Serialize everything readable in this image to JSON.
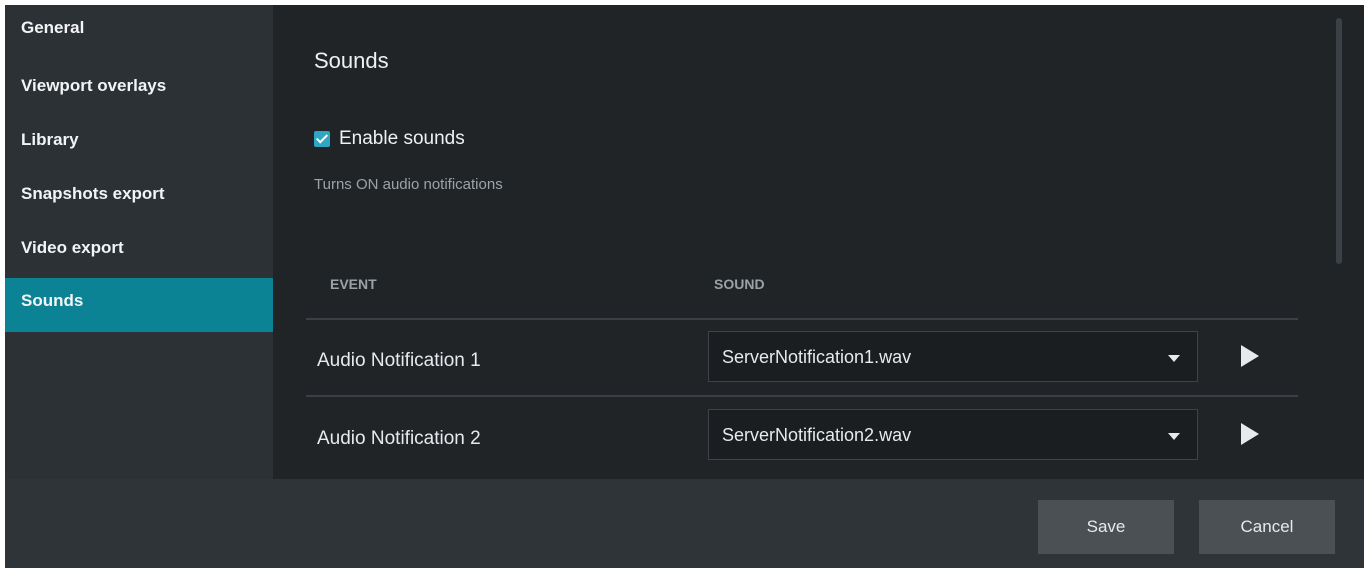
{
  "sidebar": {
    "items": [
      {
        "label": "General",
        "active": false
      },
      {
        "label": "Viewport overlays",
        "active": false
      },
      {
        "label": "Library",
        "active": false
      },
      {
        "label": "Snapshots export",
        "active": false
      },
      {
        "label": "Video export",
        "active": false
      },
      {
        "label": "Sounds",
        "active": true
      }
    ]
  },
  "main": {
    "title": "Sounds",
    "enable_sounds": {
      "label": "Enable sounds",
      "checked": true
    },
    "hint": "Turns ON audio notifications",
    "table": {
      "headers": {
        "event": "EVENT",
        "sound": "SOUND"
      },
      "rows": [
        {
          "event": "Audio Notification 1",
          "sound": "ServerNotification1.wav"
        },
        {
          "event": "Audio Notification 2",
          "sound": "ServerNotification2.wav"
        }
      ]
    }
  },
  "footer": {
    "save_label": "Save",
    "cancel_label": "Cancel"
  },
  "colors": {
    "accent": "#0b8394",
    "checkbox": "#2fa7c4",
    "background": "#202427"
  },
  "icons": {
    "checkbox": "checkmark-icon",
    "dropdown": "chevron-down-icon",
    "play": "play-icon"
  }
}
